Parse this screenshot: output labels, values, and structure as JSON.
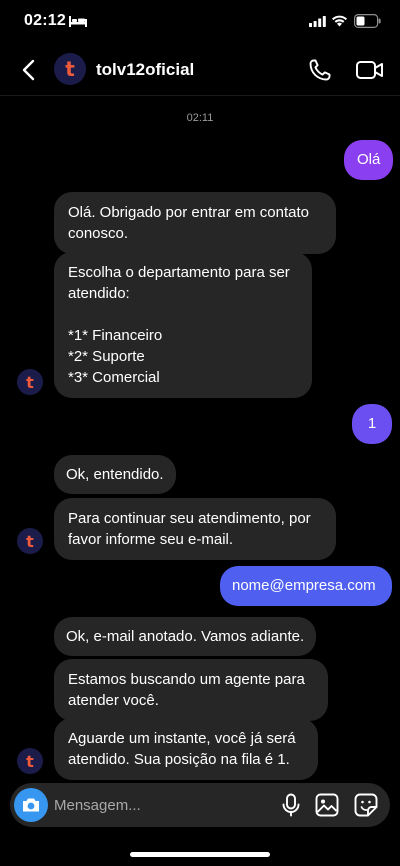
{
  "status_bar": {
    "time": "02:12",
    "icons": [
      "bed-icon",
      "signal-icon",
      "wifi-icon",
      "battery-icon"
    ]
  },
  "header": {
    "contact_name": "tolv12oficial",
    "avatar_letter": "t",
    "icons": [
      "back-icon",
      "phone-icon",
      "video-camera-icon"
    ]
  },
  "conversation": {
    "timestamp": "02:11",
    "messages": [
      {
        "from": "me",
        "text": "Olá"
      },
      {
        "from": "them",
        "text": "Olá. Obrigado por entrar em contato\nconosco."
      },
      {
        "from": "them",
        "text": "Escolha o departamento para ser\natendido:\n\n*1* Financeiro\n*2* Suporte\n*3* Comercial"
      },
      {
        "from": "me",
        "text": "1"
      },
      {
        "from": "them",
        "text": "Ok, entendido."
      },
      {
        "from": "them",
        "text": "Para continuar seu atendimento, por\nfavor informe seu e-mail."
      },
      {
        "from": "me",
        "text": "nome@empresa.com"
      },
      {
        "from": "them",
        "text": "Ok, e-mail anotado. Vamos adiante."
      },
      {
        "from": "them",
        "text": "Estamos buscando um agente para\natender você."
      },
      {
        "from": "them",
        "text": "Aguarde um instante, você já será\natendido. Sua posição na fila é 1."
      }
    ]
  },
  "composer": {
    "placeholder": "Mensagem...",
    "value": "",
    "icons": [
      "camera-icon",
      "microphone-icon",
      "gallery-icon",
      "sticker-icon"
    ]
  },
  "colors": {
    "background": "#000000",
    "incoming_bubble": "#262626",
    "outgoing_gradient_start": "#8a3ff0",
    "outgoing_gradient_end": "#4f5ff0",
    "camera_button": "#3797f0",
    "avatar_bg": "#1b1c4a",
    "avatar_letter": "#ef5a3c"
  }
}
